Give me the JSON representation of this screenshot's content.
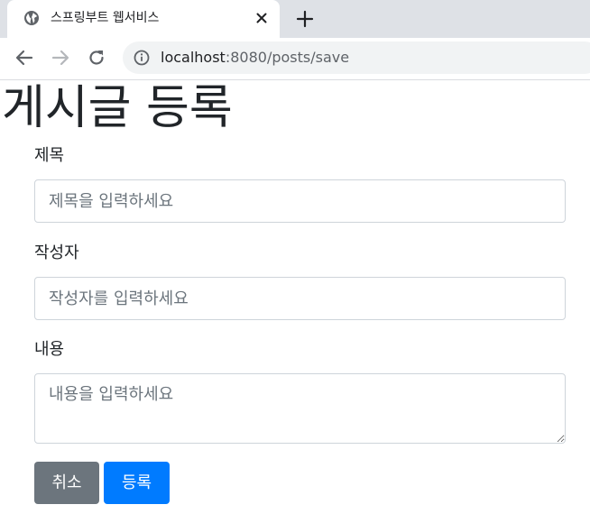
{
  "browser": {
    "tab": {
      "title": "스프링부트 웹서비스",
      "favicon": "globe-icon",
      "close_icon": "close-icon"
    },
    "new_tab_icon": "plus-icon",
    "nav": {
      "back_icon": "arrow-left-icon",
      "forward_icon": "arrow-right-icon",
      "reload_icon": "reload-icon"
    },
    "address_bar": {
      "info_icon": "info-icon",
      "host": "localhost",
      "path": ":8080/posts/save"
    }
  },
  "page": {
    "title": "게시글 등록",
    "form": {
      "title_label": "제목",
      "title_placeholder": "제목을 입력하세요",
      "author_label": "작성자",
      "author_placeholder": "작성자를 입력하세요",
      "content_label": "내용",
      "content_placeholder": "내용을 입력하세요"
    },
    "buttons": {
      "cancel_label": "취소",
      "submit_label": "등록"
    }
  },
  "colors": {
    "tabstrip_bg": "#dee1e6",
    "omnibox_bg": "#f1f3f4",
    "btn_secondary": "#6c757d",
    "btn_primary": "#007bff",
    "input_border": "#ced4da"
  }
}
